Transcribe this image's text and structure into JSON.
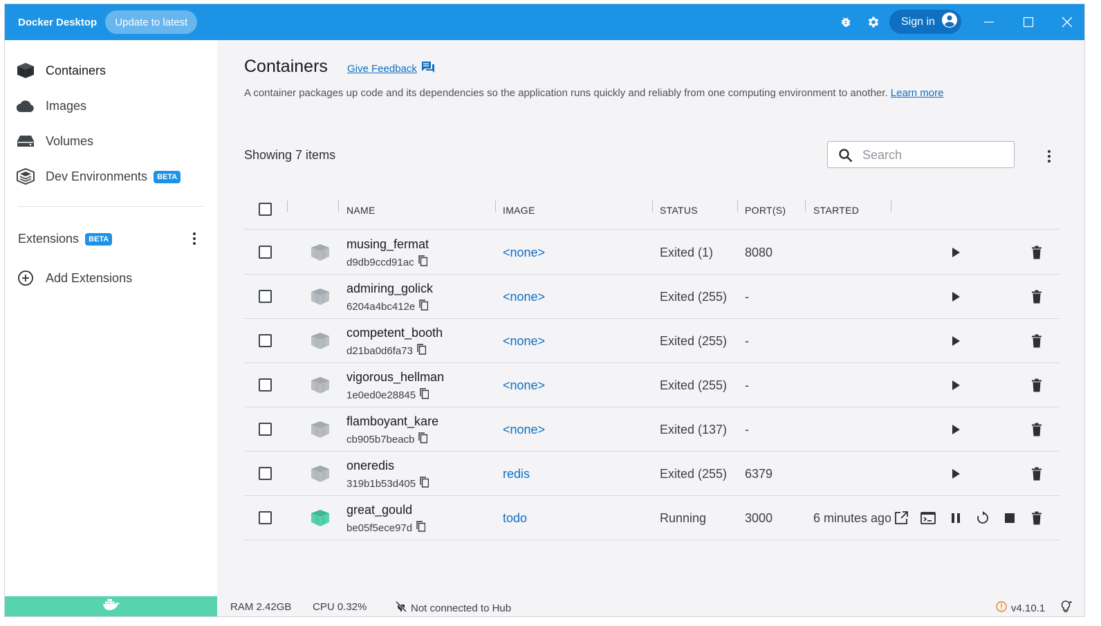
{
  "titlebar": {
    "app_name": "Docker Desktop",
    "update_label": "Update to latest",
    "signin_label": "Sign in",
    "icons": [
      "bug-icon",
      "gear-icon",
      "account-icon",
      "minimize-icon",
      "maximize-icon",
      "close-icon"
    ]
  },
  "sidebar": {
    "items": [
      {
        "label": "Containers",
        "icon": "container-icon",
        "active": true
      },
      {
        "label": "Images",
        "icon": "cloud-icon"
      },
      {
        "label": "Volumes",
        "icon": "volume-icon"
      },
      {
        "label": "Dev Environments",
        "icon": "dev-env-icon",
        "badge": "BETA"
      }
    ],
    "extensions_label": "Extensions",
    "extensions_badge": "BETA",
    "add_extensions_label": "Add Extensions"
  },
  "main": {
    "title": "Containers",
    "feedback_label": "Give Feedback",
    "description": "A container packages up code and its dependencies so the application runs quickly and reliably from one computing environment to another.",
    "learn_more": "Learn more",
    "showing": "Showing 7 items",
    "search_placeholder": "Search",
    "columns": {
      "name": "NAME",
      "image": "IMAGE",
      "status": "STATUS",
      "ports": "PORT(S)",
      "started": "STARTED"
    },
    "rows": [
      {
        "name": "musing_fermat",
        "id": "d9db9ccd91ac",
        "image": "<none>",
        "status": "Exited (1)",
        "port": "8080",
        "started": "",
        "running": false
      },
      {
        "name": "admiring_golick",
        "id": "6204a4bc412e",
        "image": "<none>",
        "status": "Exited (255)",
        "port": "-",
        "started": "",
        "running": false
      },
      {
        "name": "competent_booth",
        "id": "d21ba0d6fa73",
        "image": "<none>",
        "status": "Exited (255)",
        "port": "-",
        "started": "",
        "running": false
      },
      {
        "name": "vigorous_hellman",
        "id": "1e0ed0e28845",
        "image": "<none>",
        "status": "Exited (255)",
        "port": "-",
        "started": "",
        "running": false
      },
      {
        "name": "flamboyant_kare",
        "id": "cb905b7beacb",
        "image": "<none>",
        "status": "Exited (137)",
        "port": "-",
        "started": "",
        "running": false
      },
      {
        "name": "oneredis",
        "id": "319b1b53d405",
        "image": "redis",
        "status": "Exited (255)",
        "port": "6379",
        "started": "",
        "running": false
      },
      {
        "name": "great_gould",
        "id": "be05f5ece97d",
        "image": "todo",
        "status": "Running",
        "port": "3000",
        "started": "6 minutes ago",
        "running": true
      }
    ]
  },
  "statusbar": {
    "ram": "RAM 2.42GB",
    "cpu": "CPU 0.32%",
    "hub": "Not connected to Hub",
    "version": "v4.10.1"
  },
  "colors": {
    "titlebar": "#1d93e6",
    "accent": "#0f6fc0",
    "running": "#57d4ae",
    "stopped_icon": "#b9bec3",
    "warning": "#e8871e"
  }
}
